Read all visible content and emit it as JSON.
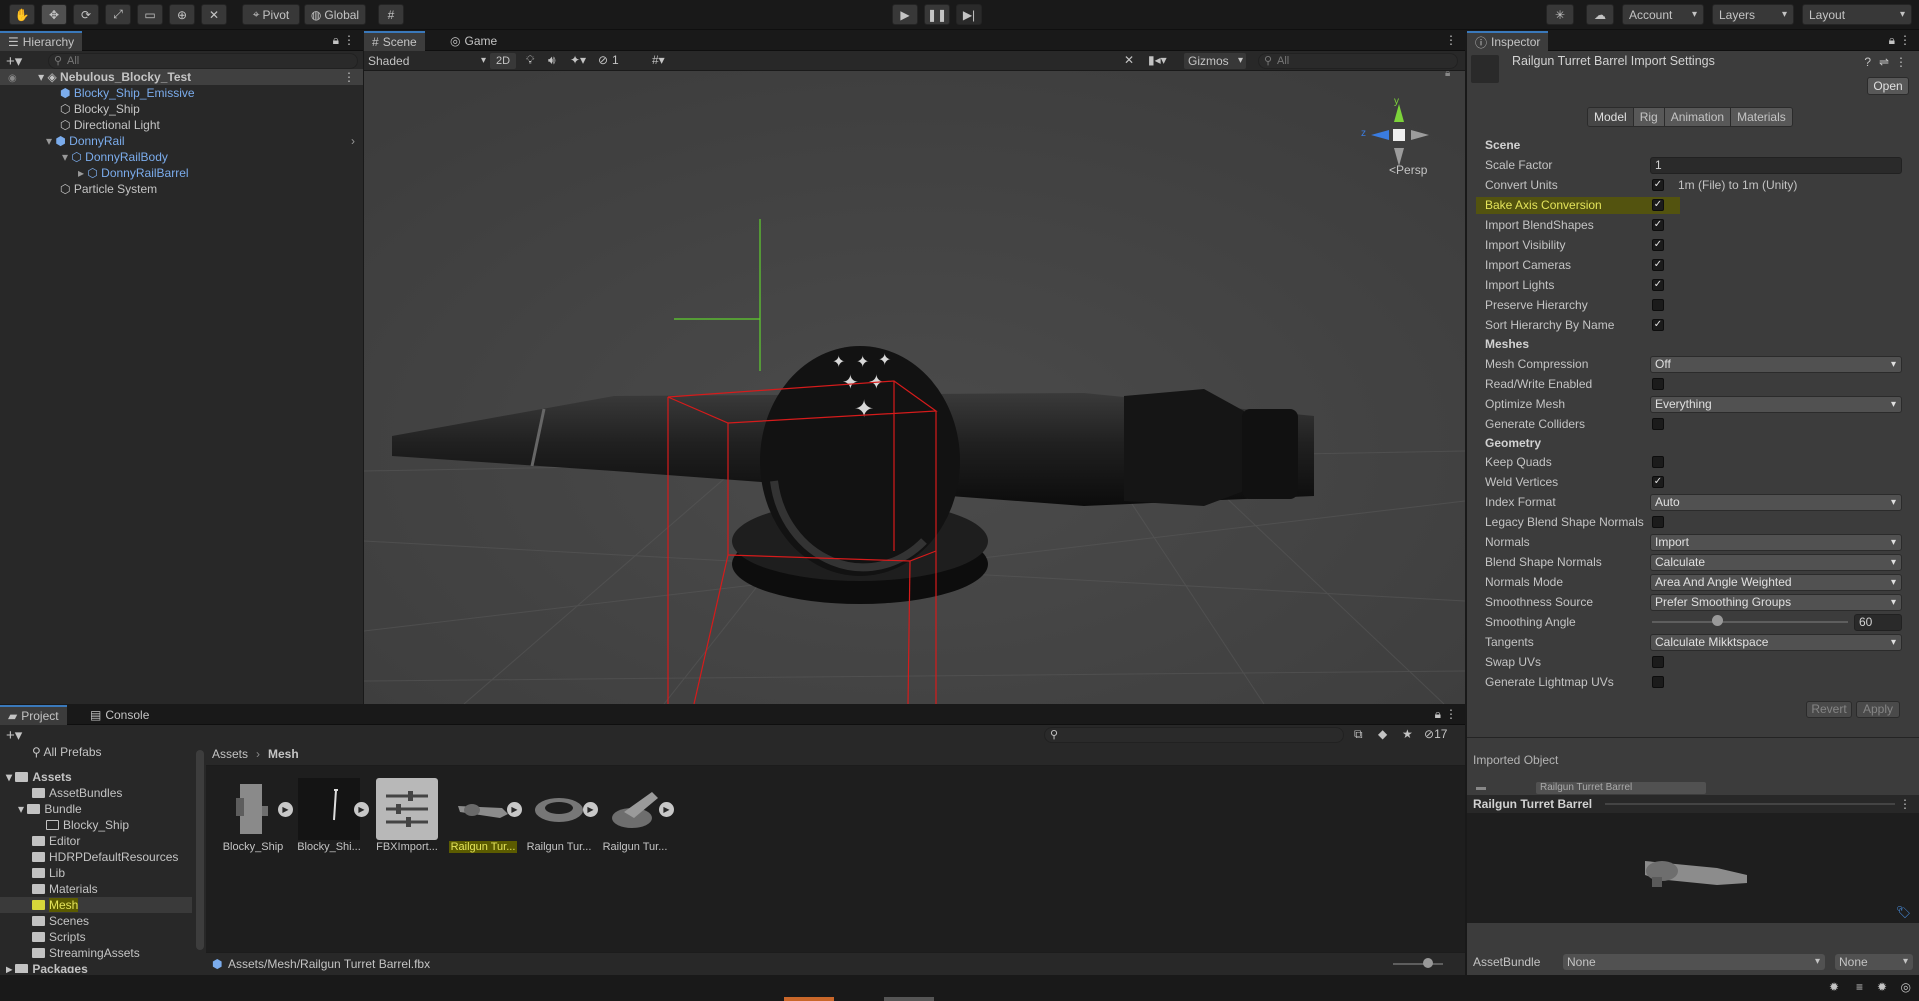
{
  "toolbar": {
    "pivot_label": "Pivot",
    "global_label": "Global",
    "account_label": "Account",
    "layers_label": "Layers",
    "layout_label": "Layout"
  },
  "hierarchy": {
    "tab_label": "Hierarchy",
    "search_placeholder": "All",
    "items": [
      {
        "label": "Nebulous_Blocky_Test"
      },
      {
        "label": "Blocky_Ship_Emissive"
      },
      {
        "label": "Blocky_Ship"
      },
      {
        "label": "Directional Light"
      },
      {
        "label": "DonnyRail"
      },
      {
        "label": "DonnyRailBody"
      },
      {
        "label": "DonnyRailBarrel"
      },
      {
        "label": "Particle System"
      }
    ]
  },
  "scene": {
    "tabs": [
      {
        "label": "Scene"
      },
      {
        "label": "Game"
      }
    ],
    "shading_mode": "Shaded",
    "mode_2d": "2D",
    "hidden_count": "1",
    "gizmos_label": "Gizmos",
    "search_placeholder": "All",
    "persp_label": "Persp",
    "axis_y": "y",
    "axis_z": "z"
  },
  "inspector": {
    "tab_label": "Inspector",
    "title": "Railgun Turret Barrel Import Settings",
    "open_label": "Open",
    "tabs": [
      {
        "label": "Model"
      },
      {
        "label": "Rig"
      },
      {
        "label": "Animation"
      },
      {
        "label": "Materials"
      }
    ],
    "scene_header": "Scene",
    "scale_factor_label": "Scale Factor",
    "scale_factor_value": "1",
    "convert_units_label": "Convert Units",
    "convert_units_note": "1m (File) to 1m (Unity)",
    "bake_axis_label": "Bake Axis Conversion",
    "import_blendshapes_label": "Import BlendShapes",
    "import_visibility_label": "Import Visibility",
    "import_cameras_label": "Import Cameras",
    "import_lights_label": "Import Lights",
    "preserve_hierarchy_label": "Preserve Hierarchy",
    "sort_hierarchy_label": "Sort Hierarchy By Name",
    "meshes_header": "Meshes",
    "mesh_compression_label": "Mesh Compression",
    "mesh_compression_value": "Off",
    "read_write_label": "Read/Write Enabled",
    "optimize_mesh_label": "Optimize Mesh",
    "optimize_mesh_value": "Everything",
    "generate_colliders_label": "Generate Colliders",
    "geometry_header": "Geometry",
    "keep_quads_label": "Keep Quads",
    "weld_vertices_label": "Weld Vertices",
    "index_format_label": "Index Format",
    "index_format_value": "Auto",
    "legacy_blend_label": "Legacy Blend Shape Normals",
    "normals_label": "Normals",
    "normals_value": "Import",
    "blend_shape_normals_label": "Blend Shape Normals",
    "blend_shape_normals_value": "Calculate",
    "normals_mode_label": "Normals Mode",
    "normals_mode_value": "Area And Angle Weighted",
    "smoothness_source_label": "Smoothness Source",
    "smoothness_source_value": "Prefer Smoothing Groups",
    "smoothing_angle_label": "Smoothing Angle",
    "smoothing_angle_value": "60",
    "smoothing_angle_fraction": 0.33,
    "tangents_label": "Tangents",
    "tangents_value": "Calculate Mikktspace",
    "swap_uvs_label": "Swap UVs",
    "generate_lightmap_label": "Generate Lightmap UVs",
    "revert_label": "Revert",
    "apply_label": "Apply",
    "imported_object_label": "Imported Object",
    "imported_object_name": "Railgun Turret Barrel",
    "preview_title": "Railgun Turret Barrel",
    "assetbundle_label": "AssetBundle",
    "assetbundle_value": "None",
    "assetbundle_variant": "None"
  },
  "project": {
    "tabs": [
      {
        "label": "Project"
      },
      {
        "label": "Console"
      }
    ],
    "hidden_count": "17",
    "all_prefabs_label": "All Prefabs",
    "tree": [
      {
        "label": "Assets"
      },
      {
        "label": "AssetBundles"
      },
      {
        "label": "Bundle"
      },
      {
        "label": "Blocky_Ship"
      },
      {
        "label": "Editor"
      },
      {
        "label": "HDRPDefaultResources"
      },
      {
        "label": "Lib"
      },
      {
        "label": "Materials"
      },
      {
        "label": "Mesh"
      },
      {
        "label": "Scenes"
      },
      {
        "label": "Scripts"
      },
      {
        "label": "StreamingAssets"
      },
      {
        "label": "Packages"
      }
    ],
    "breadcrumb": [
      {
        "label": "Assets"
      },
      {
        "label": "Mesh"
      }
    ],
    "assets": [
      {
        "label": "Blocky_Ship"
      },
      {
        "label": "Blocky_Shi..."
      },
      {
        "label": "FBXImport..."
      },
      {
        "label": "Railgun Tur..."
      },
      {
        "label": "Railgun Tur..."
      },
      {
        "label": "Railgun Tur..."
      }
    ],
    "status_path": "Assets/Mesh/Railgun Turret Barrel.fbx"
  },
  "colors": {
    "highlight": "#5b5b00",
    "selection_blue": "#7bacec",
    "accent": "#3a79bb"
  }
}
